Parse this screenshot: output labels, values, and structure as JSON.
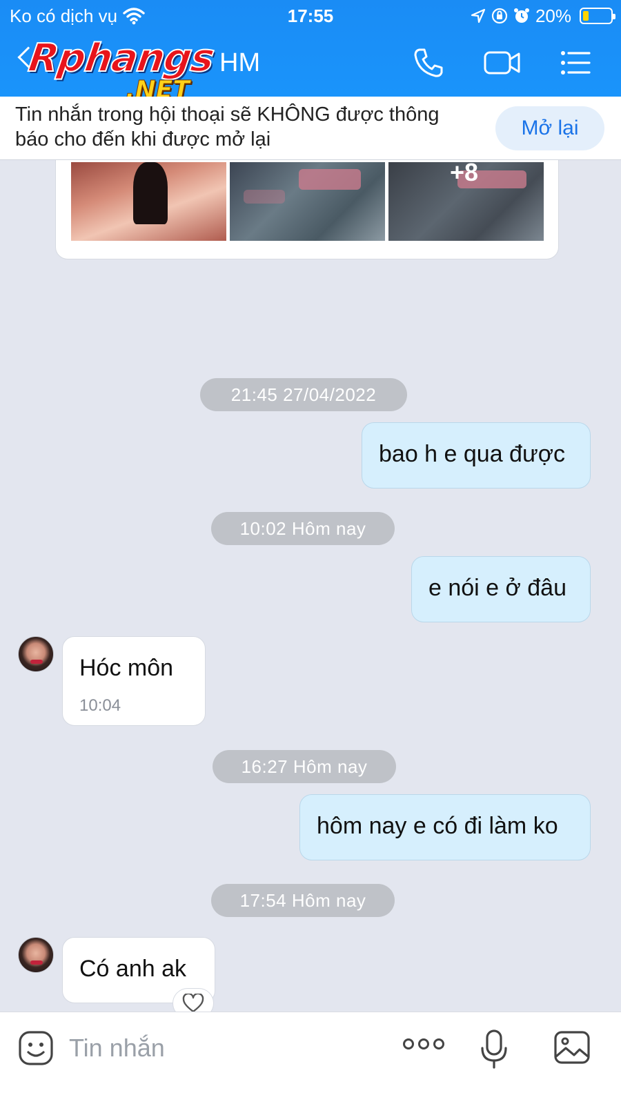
{
  "status_bar": {
    "carrier": "Ko có dịch vụ",
    "time": "17:55",
    "battery": "20%"
  },
  "header": {
    "logo_main": "Rphangs",
    "logo_sub": ".NET",
    "contact_name": "HM",
    "icons": [
      "back-icon",
      "phone-icon",
      "video-camera-icon",
      "menu-list-icon"
    ],
    "background_color": "#1a8cf5"
  },
  "mute_banner": {
    "text": "Tin nhắn trong hội thoại sẽ KHÔNG được thông báo cho đến khi được mở lại",
    "button_label": "Mở lại"
  },
  "photo_card": {
    "more_count": "+8"
  },
  "messages": [
    {
      "type": "time",
      "text": "21:45 27/04/2022"
    },
    {
      "type": "outgoing",
      "text": "bao h e qua được"
    },
    {
      "type": "time",
      "text": "10:02 Hôm nay"
    },
    {
      "type": "outgoing",
      "text": "e nói e ở đâu"
    },
    {
      "type": "incoming",
      "text": "Hóc môn",
      "time": "10:04"
    },
    {
      "type": "time",
      "text": "16:27 Hôm nay"
    },
    {
      "type": "outgoing",
      "text": "hôm nay e có đi làm ko"
    },
    {
      "type": "time",
      "text": "17:54 Hôm nay"
    },
    {
      "type": "incoming",
      "text": "Có anh ak"
    }
  ],
  "composer": {
    "placeholder": "Tin nhắn",
    "icons": [
      "sticker-icon",
      "more-icon",
      "microphone-icon",
      "image-icon"
    ]
  },
  "colors": {
    "accent": "#1a73e8",
    "outgoing_bubble": "#d6effd",
    "chat_background": "#e3e6ef"
  }
}
